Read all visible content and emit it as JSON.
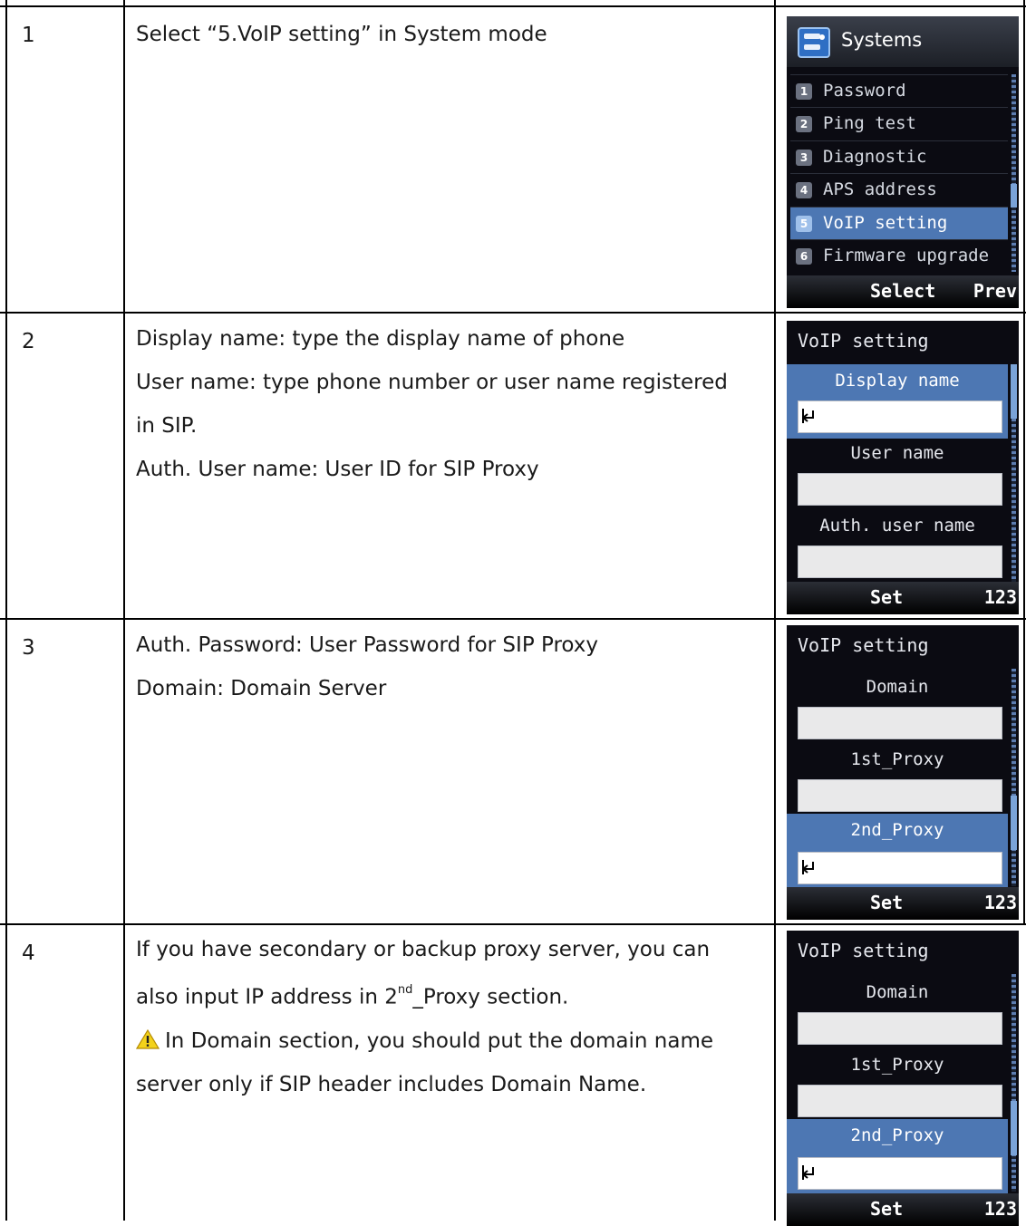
{
  "rows": [
    {
      "num": "1",
      "lines": [
        "Select “5.VoIP setting” in System mode"
      ],
      "screen": {
        "title": "Systems",
        "menu": [
          {
            "badge": "1",
            "label": "Password"
          },
          {
            "badge": "2",
            "label": "Ping test"
          },
          {
            "badge": "3",
            "label": "Diagnostic"
          },
          {
            "badge": "4",
            "label": "APS address"
          },
          {
            "badge": "5",
            "label": "VoIP setting"
          },
          {
            "badge": "6",
            "label": "Firmware upgrade"
          }
        ],
        "softkey_mid": "Select",
        "softkey_right": "Prev"
      }
    },
    {
      "num": "2",
      "lines": [
        "Display name: type the display name of phone",
        "User name: type phone number or user name registered",
        "in SIP.",
        "Auth. User name: User ID for SIP Proxy"
      ],
      "screen": {
        "title": "VoIP setting",
        "fields": [
          "Display name",
          "User name",
          "Auth. user name"
        ],
        "softkey_mid": "Set",
        "softkey_right": "123"
      }
    },
    {
      "num": "3",
      "lines": [
        "Auth. Password: User Password for SIP Proxy",
        "Domain: Domain Server"
      ],
      "screen": {
        "title": "VoIP setting",
        "fields": [
          "Domain",
          "1st_Proxy",
          "2nd_Proxy"
        ],
        "softkey_mid": "Set",
        "softkey_right": "123"
      }
    },
    {
      "num": "4",
      "line1": "If you have secondary or backup proxy server, you can",
      "line2_a": "also input IP address in 2",
      "line2_sup": "nd",
      "line2_b": "_Proxy section.",
      "line3": "In Domain section, you should put the domain name",
      "line4": "server only if SIP header includes Domain Name.",
      "screen": {
        "title": "VoIP setting",
        "fields": [
          "Domain",
          "1st_Proxy",
          "2nd_Proxy"
        ],
        "softkey_mid": "Set",
        "softkey_right": "123"
      }
    }
  ],
  "icons": {
    "warning": "warning-triangle-icon",
    "system": "systems-icon",
    "cursor": "text-cursor-icon"
  }
}
